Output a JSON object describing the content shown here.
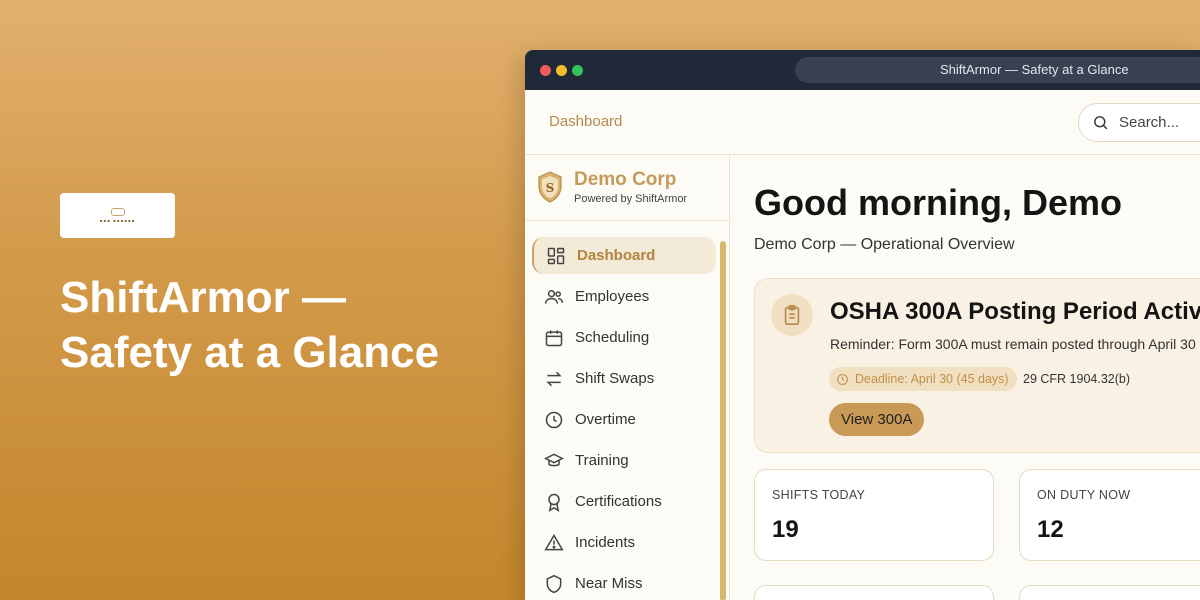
{
  "promo": {
    "headline_line1": "ShiftArmor —",
    "headline_line2": "Safety at a Glance"
  },
  "window": {
    "title": "ShiftArmor — Safety at a Glance"
  },
  "topbar": {
    "breadcrumb": "Dashboard",
    "search_placeholder": "Search..."
  },
  "brand": {
    "name": "Demo Corp",
    "subtitle": "Powered by ShiftArmor"
  },
  "sidebar": {
    "items": [
      {
        "label": "Dashboard",
        "icon": "grid-icon",
        "active": true
      },
      {
        "label": "Employees",
        "icon": "users-icon"
      },
      {
        "label": "Scheduling",
        "icon": "calendar-icon"
      },
      {
        "label": "Shift Swaps",
        "icon": "swap-arrows-icon"
      },
      {
        "label": "Overtime",
        "icon": "clock-icon"
      },
      {
        "label": "Training",
        "icon": "graduation-cap-icon"
      },
      {
        "label": "Certifications",
        "icon": "award-icon"
      },
      {
        "label": "Incidents",
        "icon": "warning-triangle-icon"
      },
      {
        "label": "Near Miss",
        "icon": "shield-icon"
      }
    ]
  },
  "main": {
    "greeting": "Good morning, Demo",
    "subtitle": "Demo Corp — Operational Overview"
  },
  "alert": {
    "title": "OSHA 300A Posting Period Activ",
    "text": "Reminder: Form 300A must remain posted through April 30",
    "deadline": "Deadline: April 30 (45 days)",
    "cfr": "29 CFR 1904.32(b)",
    "button": "View 300A"
  },
  "stats": [
    {
      "label": "SHIFTS TODAY",
      "value": "19"
    },
    {
      "label": "ON DUTY NOW",
      "value": "12"
    }
  ],
  "colors": {
    "accent": "#c99a55",
    "brand_gold": "#c49b5a",
    "titlebar": "#1f2937"
  }
}
